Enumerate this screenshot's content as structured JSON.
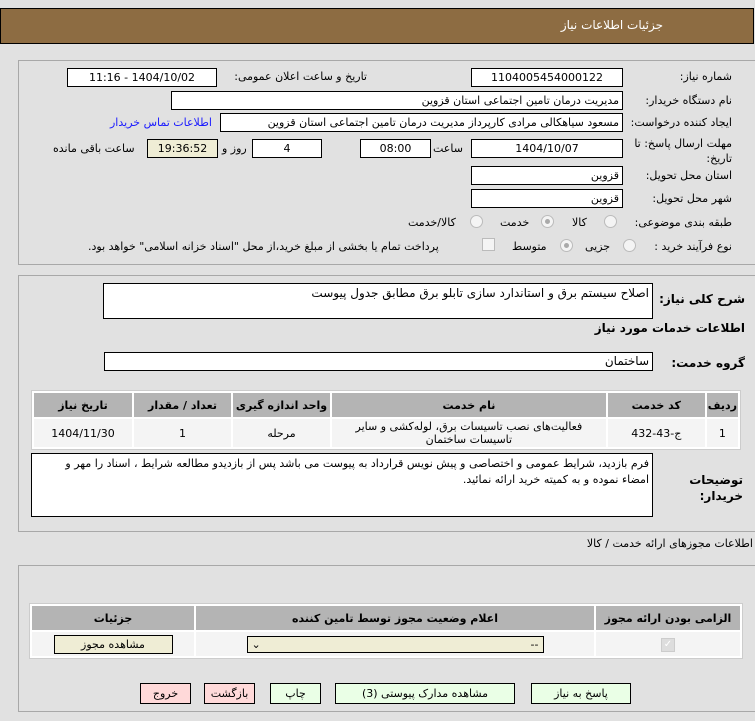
{
  "header": {
    "title": "جزئیات اطلاعات نیاز"
  },
  "form": {
    "need_number_label": "شماره نیاز:",
    "need_number": "1104005454000122",
    "announce_label": "تاریخ و ساعت اعلان عمومی:",
    "announce_value": "1404/10/02 - 11:16",
    "buyer_label": "نام دستگاه خریدار:",
    "buyer": "مدیریت درمان تامین اجتماعی استان قزوین",
    "creator_label": "ایجاد کننده درخواست:",
    "creator": "مسعود سیاهکالی مرادی کارپرداز مدیریت درمان تامین اجتماعی استان قزوین",
    "contact_link": "اطلاعات تماس خریدار",
    "deadline_label": "مهلت ارسال پاسخ: تا تاریخ:",
    "deadline_date": "1404/10/07",
    "time_label": "ساعت",
    "deadline_time": "08:00",
    "days": "4",
    "days_label": "روز و",
    "remaining": "19:36:52",
    "remaining_label": "ساعت باقی مانده",
    "province_label": "استان محل تحویل:",
    "province": "قزوین",
    "city_label": "شهر محل تحویل:",
    "city": "قزوین",
    "category_label": "طبقه بندی موضوعی:",
    "category_options": [
      "کالا",
      "خدمت",
      "کالا/خدمت"
    ],
    "category_selected": "خدمت",
    "process_label": "نوع فرآیند خرید :",
    "process_options": [
      "جزیی",
      "متوسط"
    ],
    "process_selected": "متوسط",
    "payment_note": "پرداخت تمام یا بخشی از مبلغ خرید،از محل \"اسناد خزانه اسلامی\" خواهد بود."
  },
  "details": {
    "desc_label": "شرح کلی نیاز:",
    "desc": "اصلاح سیستم برق و استاندارد سازی تابلو برق مطابق جدول پیوست",
    "services_title": "اطلاعات خدمات مورد نیاز",
    "group_label": "گروه خدمت:",
    "group": "ساختمان",
    "columns": [
      "ردیف",
      "کد خدمت",
      "نام خدمت",
      "واحد اندازه گیری",
      "تعداد / مقدار",
      "تاریخ نیاز"
    ],
    "rows": [
      [
        "1",
        "ج-43-432",
        "فعالیت‌های نصب تاسیسات برق، لوله‌کشی و سایر تاسیسات ساختمان",
        "مرحله",
        "1",
        "1404/11/30"
      ]
    ],
    "notes_label": "توضیحات خریدار:",
    "notes": "فرم بازدید، شرایط عمومی و اختصاصی و پیش نویس قرارداد به پیوست می باشد پس از بازدیدو مطالعه شرایط ، اسناد را مهر و امضاء نموده و به کمیته خرید ارائه نمائید."
  },
  "permits": {
    "title": "اطلاعات مجوزهای ارائه خدمت / کالا",
    "columns": [
      "الزامی بودن ارائه مجوز",
      "اعلام وضعیت مجوز توسط تامین کننده",
      "جزئیات"
    ],
    "select_value": "--",
    "view_button": "مشاهده مجوز",
    "required_checked": true
  },
  "buttons": {
    "reply": "پاسخ به نیاز",
    "attachments": "مشاهده مدارک پیوستی (3)",
    "print": "چاپ",
    "back": "بازگشت",
    "exit": "خروج"
  }
}
